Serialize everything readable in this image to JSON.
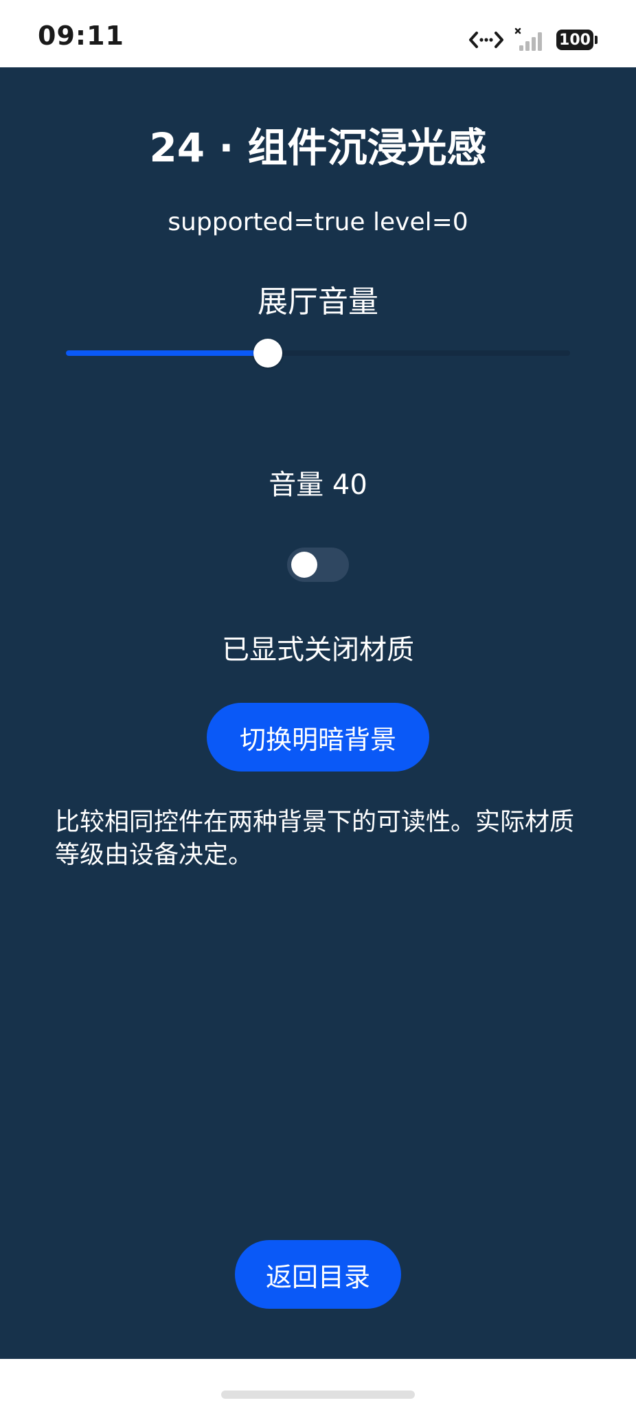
{
  "status_bar": {
    "time": "09:11",
    "battery": "100",
    "icons": [
      "data-transfer-icon",
      "no-signal-icon",
      "signal-bars-icon",
      "battery-icon"
    ]
  },
  "main": {
    "title": "24 · 组件沉浸光感",
    "level_text": "supported=true level=0",
    "volume_label": "展厅音量",
    "slider": {
      "value": 40,
      "min": 0,
      "max": 100
    },
    "volume_value": "音量 40",
    "toggle": {
      "on": false
    },
    "material_status": "已显式关闭材质",
    "toggle_bg_button": "切换明暗背景",
    "description": "比较相同控件在两种背景下的可读性。实际材质等级由设备决定。",
    "back_button": "返回目录"
  },
  "colors": {
    "background": "#17324b",
    "accent": "#0a59f7",
    "track": "#142b42",
    "toggle_off": "#2f4761",
    "text": "#ffffff"
  }
}
